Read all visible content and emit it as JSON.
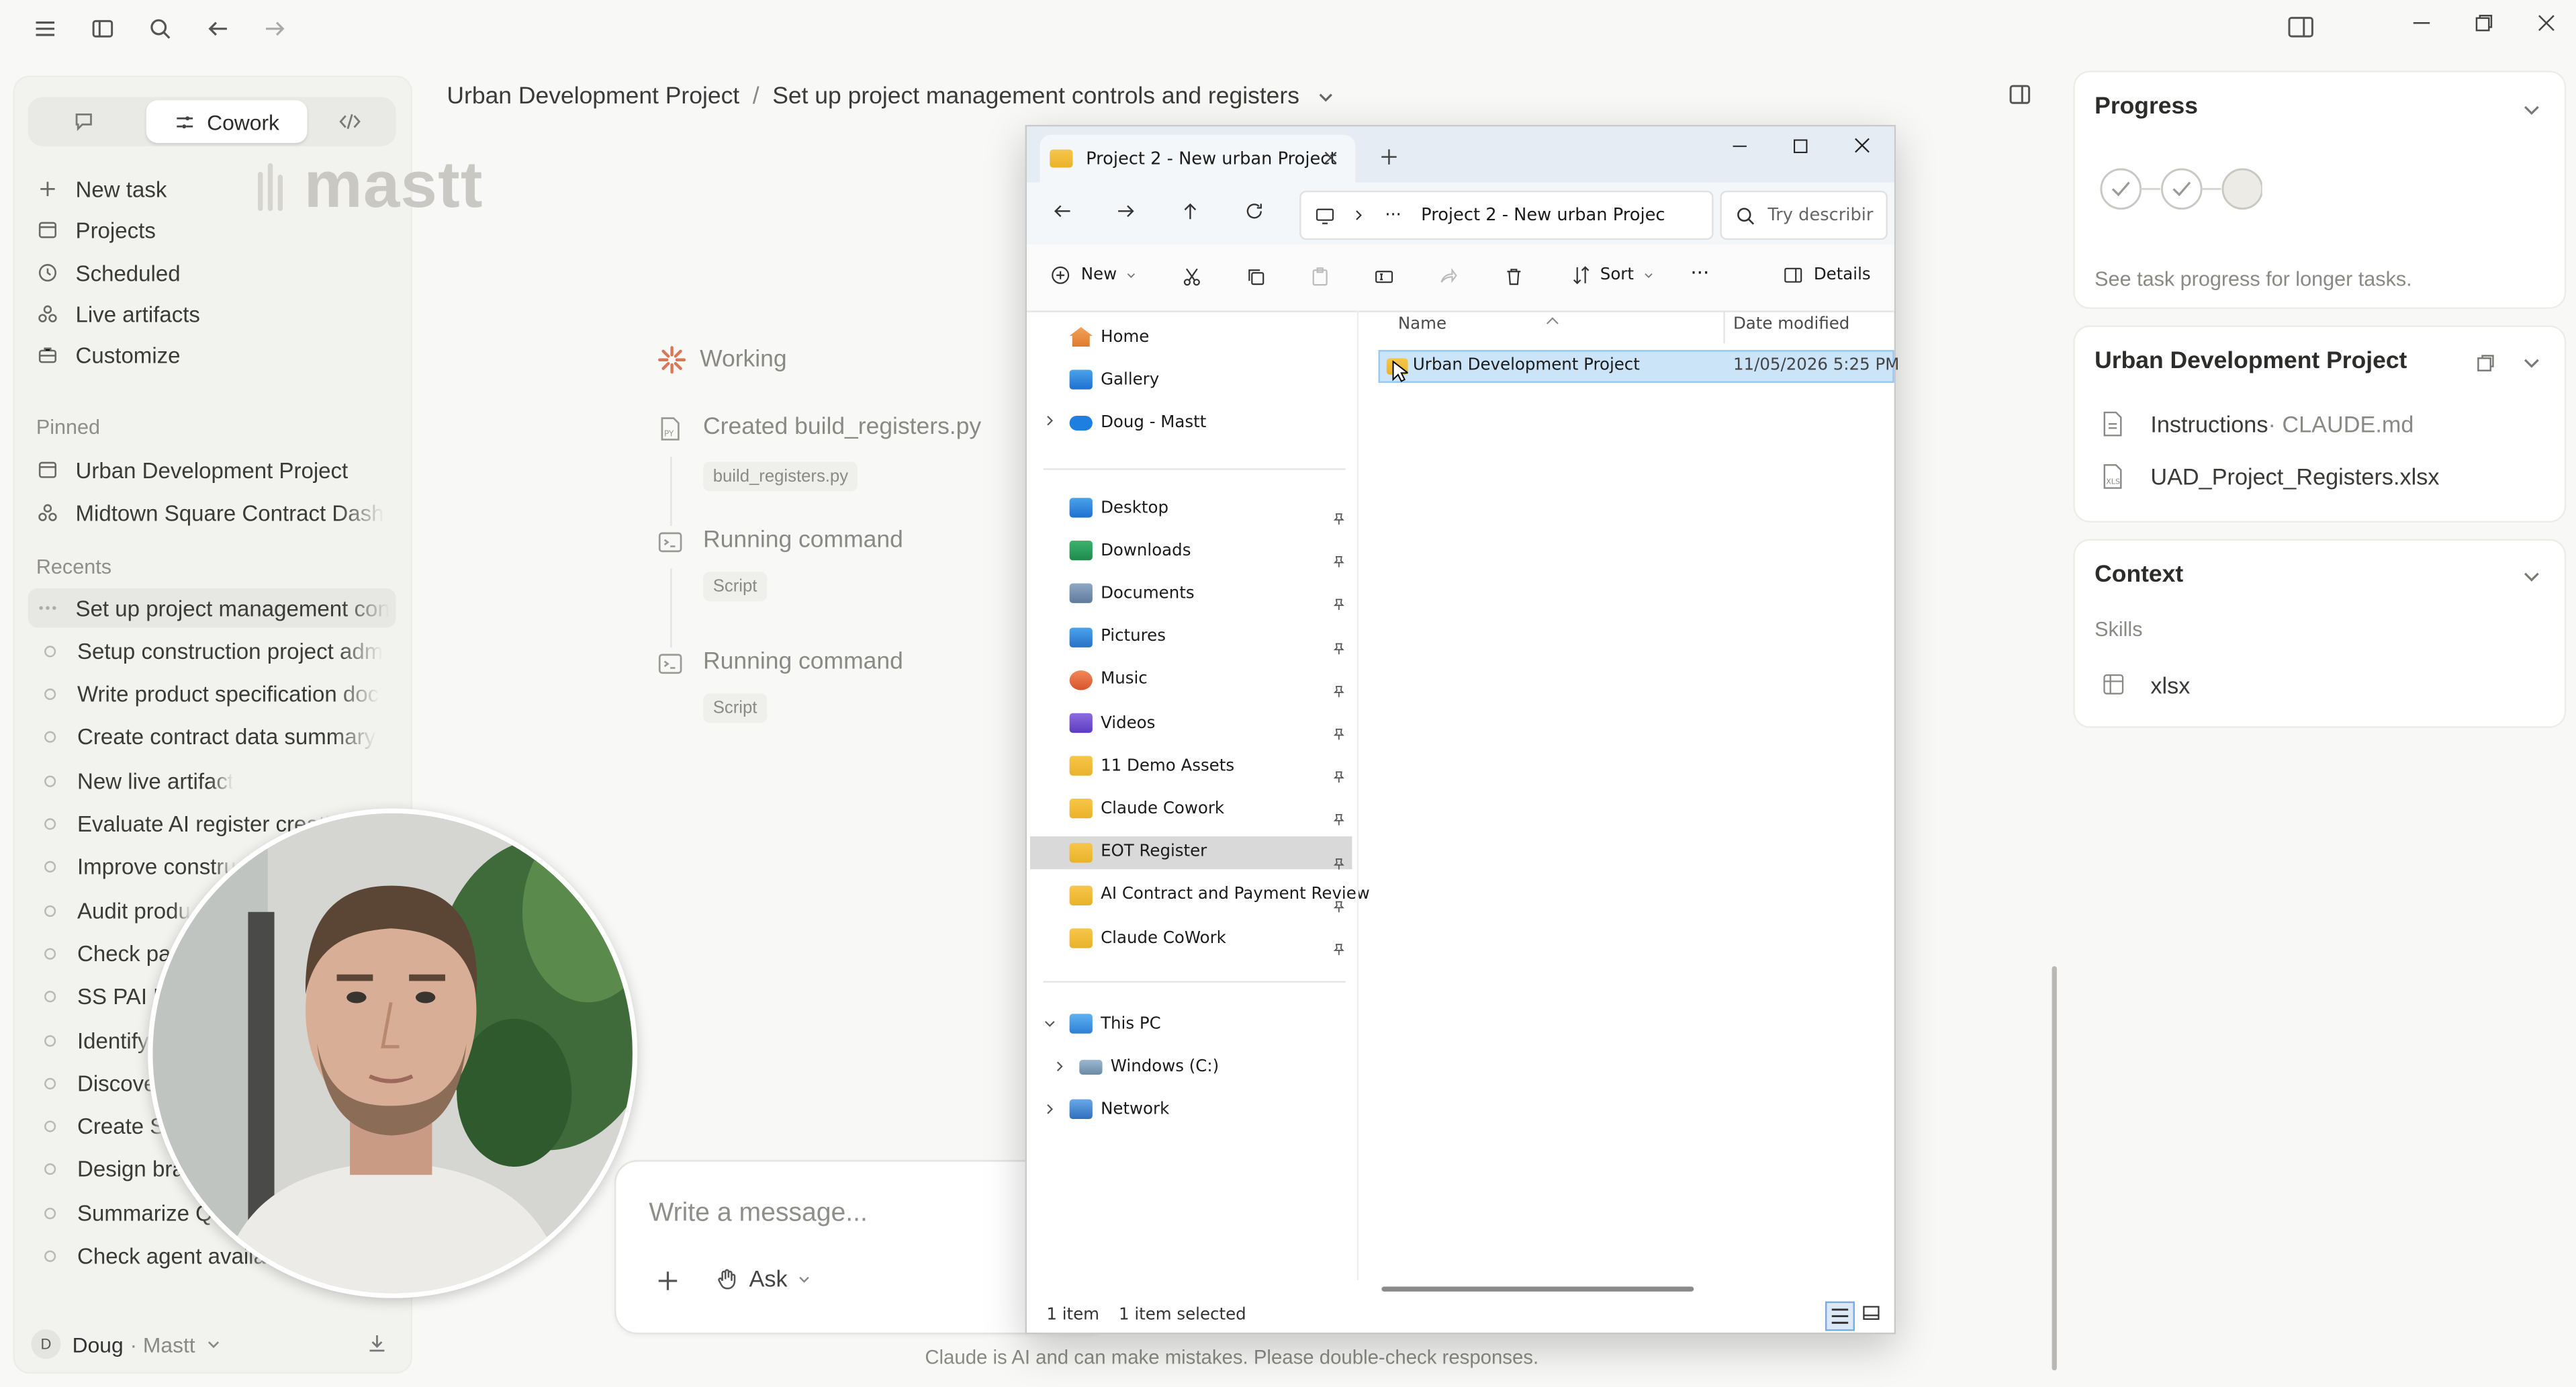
{
  "top_bar": {
    "icons": [
      "menu-icon",
      "sidebar-toggle-icon",
      "search-icon",
      "back-arrow-icon",
      "forward-arrow-icon",
      "panel-icon",
      "minimize-icon",
      "restore-icon",
      "close-icon"
    ]
  },
  "sidebar": {
    "mode_tabs": [
      {
        "label": "",
        "icon": "chat-icon"
      },
      {
        "label": "Cowork",
        "icon": "cowork-icon"
      },
      {
        "label": "",
        "icon": "code-icon"
      }
    ],
    "logo_text": "mastt",
    "nav": [
      "New task",
      "Projects",
      "Scheduled",
      "Live artifacts",
      "Customize"
    ],
    "pinned_label": "Pinned",
    "pinned": [
      "Urban Development Project",
      "Midtown Square Contract Dash"
    ],
    "recents_label": "Recents",
    "recents": [
      "Set up project management con",
      "Setup construction project adm",
      "Write product specification doc",
      "Create contract data summary",
      "New live artifact",
      "Evaluate AI register creati",
      "Improve constru",
      "Audit produ",
      "Check pay",
      "SS PAI R",
      "Identify",
      "Discove",
      "Create S",
      "Design brar",
      "Summarize Q4",
      "Check agent availab"
    ],
    "user_initial": "D",
    "user_name": "Doug",
    "user_org": "· Mastt"
  },
  "main": {
    "breadcrumb_project": "Urban Development Project",
    "breadcrumb_sep": "/",
    "breadcrumb_task": "Set up project management controls and registers",
    "status": "Working",
    "steps": [
      {
        "title": "Created build_registers.py",
        "chip": "build_registers.py"
      },
      {
        "title": "Running command",
        "chip": "Script"
      },
      {
        "title": "Running command",
        "chip": "Script"
      }
    ],
    "composer_placeholder": "Write a message...",
    "ask_label": "Ask",
    "disclaimer": "Claude is AI and can make mistakes. Please double-check responses."
  },
  "explorer": {
    "tab_title": "Project 2 - New urban Project",
    "address_ellipsis": "···",
    "address": "Project 2 - New urban Projec",
    "search_placeholder": "Try describir",
    "cmd_new": "New",
    "cmd_sort": "Sort",
    "cmd_more": "···",
    "cmd_details": "Details",
    "tree_quick": [
      "Home",
      "Gallery",
      "Doug - Mastt"
    ],
    "tree_pinned": [
      "Desktop",
      "Downloads",
      "Documents",
      "Pictures",
      "Music",
      "Videos",
      "11 Demo Assets",
      "Claude Cowork",
      "EOT Register",
      "AI Contract and Payment Review",
      "Claude CoWork"
    ],
    "tree_pc": [
      "This PC",
      "Windows (C:)",
      "Network"
    ],
    "col_name": "Name",
    "col_date": "Date modified",
    "files": [
      {
        "name": "Urban Development Project",
        "date": "11/05/2026 5:25 PM"
      }
    ],
    "status_count": "1 item",
    "status_selected": "1 item selected"
  },
  "right_panel": {
    "progress_title": "Progress",
    "progress_hint": "See task progress for longer tasks.",
    "project_title": "Urban Development Project",
    "project_files": [
      {
        "name": "Instructions",
        "sub": " · CLAUDE.md"
      },
      {
        "name": "UAD_Project_Registers.xlsx",
        "sub": ""
      }
    ],
    "context_title": "Context",
    "skills_label": "Skills",
    "skills": [
      "xlsx"
    ]
  },
  "colors": {
    "accent": "#d97757",
    "selection": "#cce4f7",
    "folder": "#f3bf3f"
  }
}
